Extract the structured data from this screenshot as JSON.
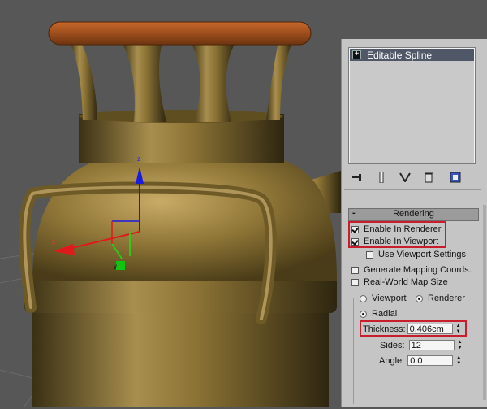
{
  "stack": {
    "items": [
      {
        "label": "Editable Spline"
      }
    ]
  },
  "toolbar": {
    "icons": [
      "pin-stack-icon",
      "show-end-result-icon",
      "make-unique-icon",
      "remove-modifier-icon",
      "configure-modifier-sets-icon"
    ]
  },
  "rendering": {
    "title": "Rendering",
    "collapse_glyph": "-",
    "enable_in_renderer": {
      "label": "Enable In Renderer",
      "checked": true
    },
    "enable_in_viewport": {
      "label": "Enable In Viewport",
      "checked": true
    },
    "use_viewport_settings": {
      "label": "Use Viewport Settings",
      "checked": false
    },
    "generate_mapping_coords": {
      "label": "Generate Mapping Coords.",
      "checked": false
    },
    "real_world_map_size": {
      "label": "Real-World Map Size",
      "checked": false
    },
    "viewport_radio": {
      "label": "Viewport",
      "selected": false
    },
    "renderer_radio": {
      "label": "Renderer",
      "selected": true
    },
    "radial_radio": {
      "label": "Radial",
      "selected": true
    },
    "thickness": {
      "label": "Thickness:",
      "value": "0.406cm"
    },
    "sides": {
      "label": "Sides:",
      "value": "12"
    },
    "angle": {
      "label": "Angle:",
      "value": "0.0"
    }
  },
  "gizmo": {
    "x_label": "x",
    "y_label": "y",
    "z_label": "z"
  },
  "colors": {
    "viewport_bg": "#575757",
    "highlight": "#c81e2c",
    "stack_item": "#505868",
    "body_metal": "#8a7133",
    "lid": "#a3521a"
  }
}
